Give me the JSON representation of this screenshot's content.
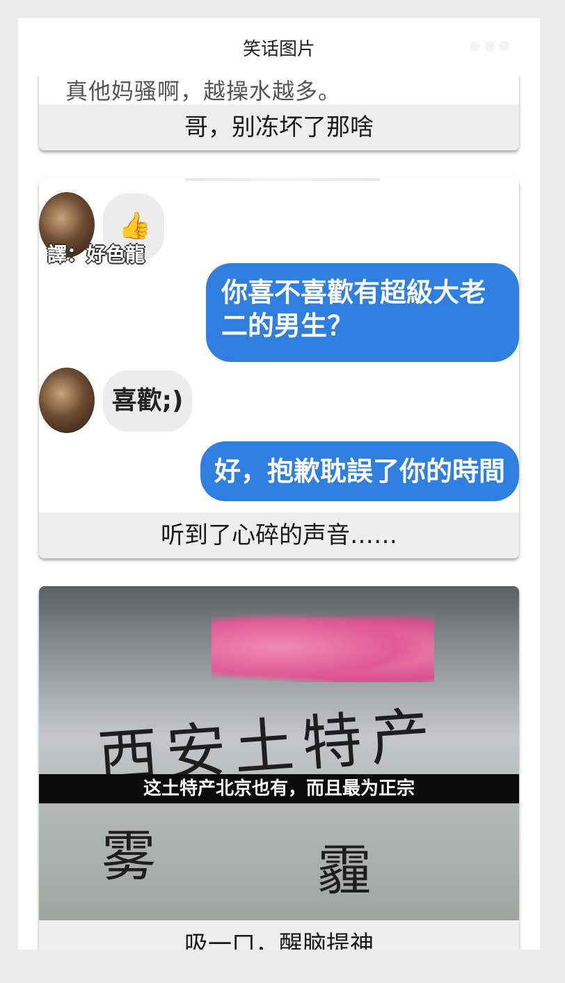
{
  "header": {
    "title": "笑话图片"
  },
  "posts": [
    {
      "image_text": "真他妈骚啊，越操水越多。",
      "caption": "哥，别冻坏了那啥"
    },
    {
      "chat": {
        "translator_label": "譯：好色龍",
        "msg1": "你喜不喜歡有超級大老二的男生？",
        "reply1": "喜歡;)",
        "msg2": "好，抱歉耽誤了你的時間",
        "thumbs": "👍"
      },
      "caption": "听到了心碎的声音……"
    },
    {
      "photo": {
        "top_handwriting": "西安土特产",
        "subtitle": "这土特产北京也有，而且最为正宗",
        "bottom_left": "雾",
        "bottom_right": "霾"
      },
      "caption": "吸一口，醒脑提神"
    }
  ]
}
